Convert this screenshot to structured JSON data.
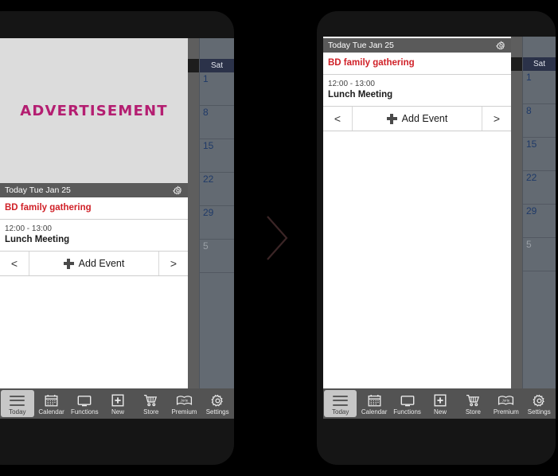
{
  "meta": {
    "background_color": "#000000",
    "accent_magenta": "#b41e71",
    "accent_red": "#d02128",
    "chevron_color": "#3b2526"
  },
  "advertisement": {
    "label": "ADVERTISEMENT"
  },
  "today_panel": {
    "header_title": "Today Tue Jan 25",
    "gear_icon": "gear-icon",
    "events": [
      {
        "kind": "all-day",
        "title": "BD family gathering"
      },
      {
        "kind": "timed",
        "time": "12:00 - 13:00",
        "title": "Lunch Meeting"
      }
    ],
    "add_bar": {
      "prev_label": "<",
      "add_label": "Add Event",
      "plus_icon": "plus-icon",
      "next_label": ">"
    }
  },
  "calendar_strip": {
    "column_header": "Sat",
    "cells": [
      {
        "label": "1",
        "dim": false
      },
      {
        "label": "8",
        "dim": false
      },
      {
        "label": "15",
        "dim": false
      },
      {
        "label": "22",
        "dim": false
      },
      {
        "label": "29",
        "dim": false
      },
      {
        "label": "5",
        "dim": true
      }
    ]
  },
  "bottom_nav": {
    "items": [
      {
        "label": "Today",
        "icon": "hamburger-icon",
        "active": true
      },
      {
        "label": "Calendar",
        "icon": "calendar-icon",
        "active": false
      },
      {
        "label": "Functions",
        "icon": "monitor-icon",
        "active": false
      },
      {
        "label": "New",
        "icon": "plus-box-icon",
        "active": false
      },
      {
        "label": "Store",
        "icon": "cart-icon",
        "active": false
      },
      {
        "label": "Premium",
        "icon": "jorte-book-icon",
        "active": false,
        "icon_text": "Jorte"
      },
      {
        "label": "Settings",
        "icon": "gear-icon",
        "active": false
      }
    ]
  },
  "transition": {
    "chevron_icon": "chevron-right-icon"
  }
}
